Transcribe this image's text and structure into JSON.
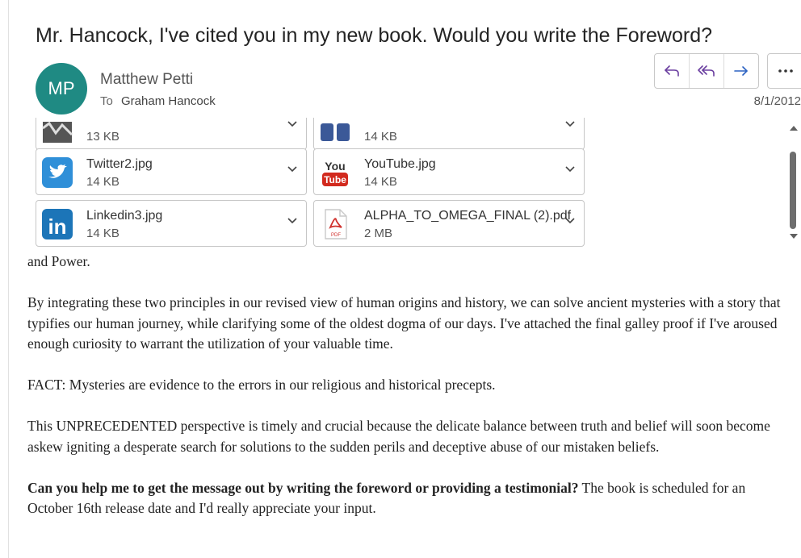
{
  "email": {
    "subject": "Mr. Hancock, I've cited you in my new book. Would you write the Foreword?",
    "avatar_initials": "MP",
    "avatar_color": "#1f8a83",
    "sender_name": "Matthew Petti",
    "to_label": "To",
    "recipient": "Graham Hancock",
    "date": "8/1/2012",
    "actions": [
      "reply-icon",
      "reply-all-icon",
      "forward-icon",
      "more-icon"
    ]
  },
  "attachments": [
    {
      "name": "",
      "size": "13 KB",
      "icon": "image-icon"
    },
    {
      "name": "",
      "size": "14 KB",
      "icon": "facebook-icon"
    },
    {
      "name": "Twitter2.jpg",
      "size": "14 KB",
      "icon": "twitter-icon"
    },
    {
      "name": "YouTube.jpg",
      "size": "14 KB",
      "icon": "youtube-icon"
    },
    {
      "name": "Linkedin3.jpg",
      "size": "14 KB",
      "icon": "linkedin-icon"
    },
    {
      "name": "ALPHA_TO_OMEGA_FINAL (2).pdf",
      "size": "2 MB",
      "icon": "pdf-icon"
    }
  ],
  "youtube_icon_text": {
    "top": "You",
    "bottom": "Tube"
  },
  "pdf_icon_text": "PDF",
  "linkedin_icon_text": "in",
  "body": {
    "p0": "and Power.",
    "p1": "By integrating these two principles in our revised view of human origins and history, we can solve ancient mysteries with a story that typifies our human journey, while clarifying some of the oldest dogma of our days. I've attached the final galley proof if I've aroused enough curiosity to warrant the utilization of your valuable time.",
    "p2": "FACT: Mysteries are evidence to the errors in our religious and historical precepts.",
    "p3": "This UNPRECEDENTED perspective is timely and crucial because the delicate balance between truth and belief will soon become askew igniting a desperate search for solutions to the sudden perils and deceptive abuse of our mistaken beliefs.",
    "p4_bold": "Can you help me to get the message out by writing the foreword or providing a testimonial?",
    "p4_rest": " The book is scheduled for an October 16th release date and I'd really appreciate your input."
  }
}
